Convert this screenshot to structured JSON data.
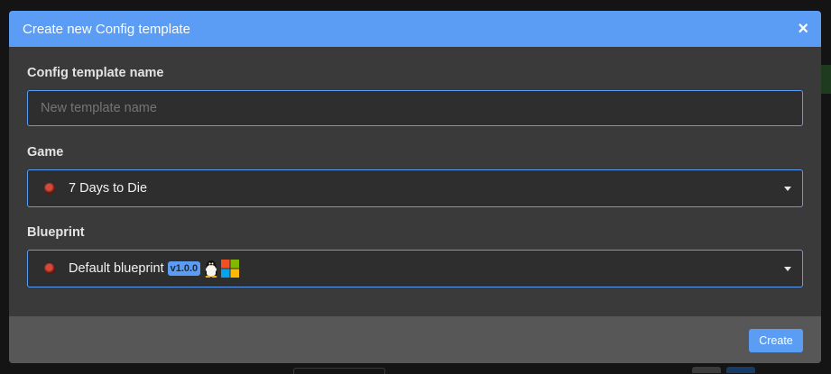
{
  "modal": {
    "title": "Create new Config template",
    "close_glyph": "×"
  },
  "fields": {
    "name": {
      "label": "Config template name",
      "value": "",
      "placeholder": "New template name"
    },
    "game": {
      "label": "Game",
      "selected": "7 Days to Die",
      "icon": "game-icon"
    },
    "blueprint": {
      "label": "Blueprint",
      "selected": "Default blueprint",
      "version": "v1.0.0",
      "platform_icons": [
        "linux-icon",
        "windows-icon"
      ]
    }
  },
  "footer": {
    "create_label": "Create"
  },
  "colors": {
    "accent": "#5b9cf4",
    "modal_bg": "#3a3a3a",
    "input_bg": "#2e2e2e",
    "footer_bg": "#575757"
  }
}
